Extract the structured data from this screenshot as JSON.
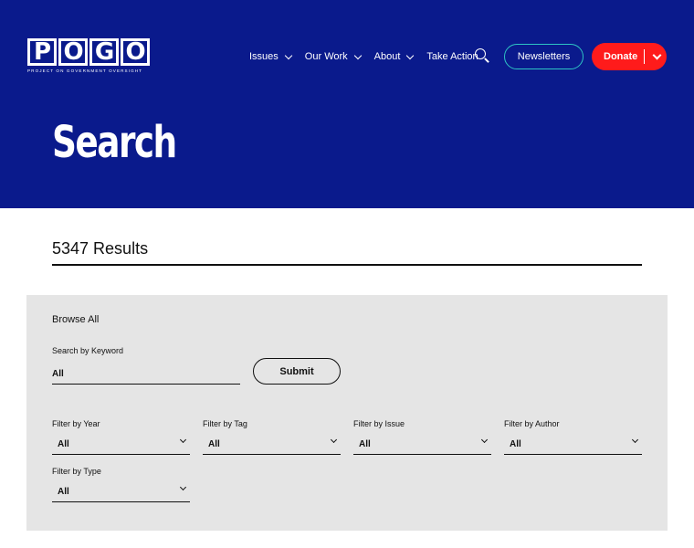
{
  "header": {
    "logo_text": "POGO",
    "logo_letters": [
      "P",
      "O",
      "G",
      "O"
    ],
    "logo_tagline": "PROJECT ON GOVERNMENT OVERSIGHT",
    "nav": [
      {
        "label": "Issues",
        "has_dropdown": true
      },
      {
        "label": "Our Work",
        "has_dropdown": true
      },
      {
        "label": "About",
        "has_dropdown": true
      },
      {
        "label": "Take Action",
        "has_dropdown": false
      }
    ],
    "search_icon": "search-icon",
    "newsletters_label": "Newsletters",
    "donate_label": "Donate",
    "colors": {
      "brand_blue": "#0a1a8c",
      "donate_red": "#ff1b1b",
      "newsletter_outline": "#2ec4c4"
    }
  },
  "page": {
    "title": "Search",
    "results_count": "5347 Results"
  },
  "filters": {
    "browse_title": "Browse All",
    "keyword_label": "Search by Keyword",
    "keyword_value": "All",
    "submit_label": "Submit",
    "selects": [
      {
        "label": "Filter by Year",
        "value": "All"
      },
      {
        "label": "Filter by Tag",
        "value": "All"
      },
      {
        "label": "Filter by Issue",
        "value": "All"
      },
      {
        "label": "Filter by Author",
        "value": "All"
      },
      {
        "label": "Filter by Type",
        "value": "All"
      }
    ]
  }
}
